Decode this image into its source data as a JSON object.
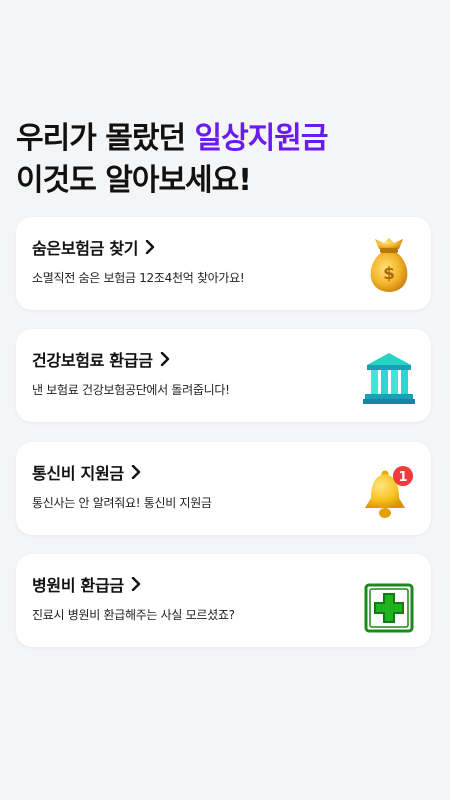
{
  "headline": {
    "line1_prefix": "우리가 몰랐던 ",
    "line1_accent": "일상지원금",
    "line2": "이것도 알아보세요!"
  },
  "cards": [
    {
      "title": "숨은보험금 찾기",
      "desc": "소멸직전 숨은 보험금 12조4천억 찾아가요!",
      "icon": "money-bag-icon"
    },
    {
      "title": "건강보험료 환급금",
      "desc": "낸 보험료 건강보험공단에서 돌려줍니다!",
      "icon": "bank-building-icon"
    },
    {
      "title": "통신비 지원금",
      "desc": "통신사는 안 알려줘요! 통신비 지원금",
      "icon": "notification-bell-icon",
      "badge": "1"
    },
    {
      "title": "병원비 환급금",
      "desc": "진료시 병원비 환급해주는 사실 모르셨죠?",
      "icon": "medical-cross-icon"
    }
  ],
  "chevron": "›",
  "colors": {
    "accent": "#6a1bf0",
    "background": "#f4f5f7",
    "card": "#ffffff"
  }
}
